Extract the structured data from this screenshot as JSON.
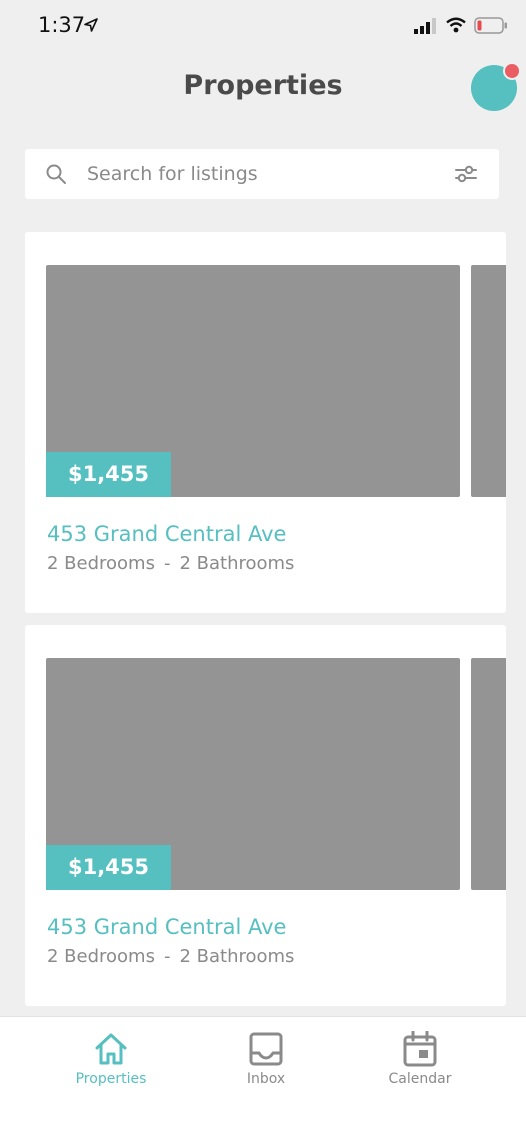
{
  "status_bar": {
    "time": "1:37",
    "location_icon": "location-arrow-icon",
    "signal_icon": "cellular-signal-icon",
    "wifi_icon": "wifi-icon",
    "battery_icon": "battery-low-icon",
    "battery_color": "#e5484d"
  },
  "header": {
    "title": "Properties",
    "avatar_color": "#56bfc0",
    "notification_dot_color": "#ea5e63"
  },
  "search": {
    "placeholder": "Search for listings",
    "value": "",
    "search_icon": "search-icon",
    "filter_icon": "filter-sliders-icon"
  },
  "listings": [
    {
      "price": "$1,455",
      "title": "453 Grand Central Ave",
      "bedrooms": "2 Bedrooms",
      "separator": "-",
      "bathrooms": "2 Bathrooms"
    },
    {
      "price": "$1,455",
      "title": "453 Grand Central Ave",
      "bedrooms": "2 Bedrooms",
      "separator": "-",
      "bathrooms": "2 Bathrooms"
    }
  ],
  "tab_bar": {
    "tabs": [
      {
        "label": "Properties",
        "icon": "home-icon",
        "active": true
      },
      {
        "label": "Inbox",
        "icon": "inbox-icon",
        "active": false
      },
      {
        "label": "Calendar",
        "icon": "calendar-icon",
        "active": false
      }
    ],
    "active_color": "#56bfc0",
    "inactive_color": "#8a8a8a"
  },
  "colors": {
    "accent": "#56bfc0",
    "image_placeholder": "#949494",
    "background": "#efefef"
  }
}
